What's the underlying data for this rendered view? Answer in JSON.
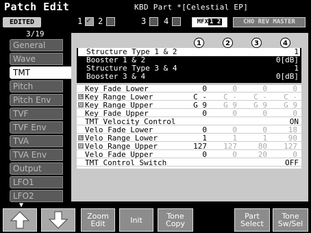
{
  "header": {
    "title": "Patch Edit",
    "part": "KBD Part *[Celestial EP]",
    "status_badge": "EDITED",
    "tones": [
      {
        "num": "1",
        "on": true
      },
      {
        "num": "2",
        "on": false
      },
      {
        "num": "3",
        "on": false
      },
      {
        "num": "4",
        "on": false
      }
    ],
    "fx1_label": "MFX",
    "fx1_inv": "1 2",
    "fx2_label": "CHO REV MASTER"
  },
  "sidebar": {
    "page_counter": "3/19",
    "tabs": [
      "General",
      "Wave",
      "TMT",
      "Pitch",
      "Pitch Env",
      "TVF",
      "TVF Env",
      "TVA",
      "TVA Env",
      "Output",
      "LFO1",
      "LFO2"
    ],
    "active_tab": "TMT"
  },
  "column_headers": [
    "1",
    "2",
    "3",
    "4"
  ],
  "structure": [
    {
      "label": "Structure Type 1 & 2",
      "value": "1"
    },
    {
      "label": "Booster 1 & 2",
      "value": "0[dB]"
    },
    {
      "label": "Structure Type 3 & 4",
      "value": "1"
    },
    {
      "label": "Booster 3 & 4",
      "value": "0[dB]"
    }
  ],
  "rows": [
    {
      "label": "Key Fade Lower",
      "marker": "",
      "values": [
        "0",
        "0",
        "0",
        "0"
      ]
    },
    {
      "label": "Key Range Lower",
      "marker": "L",
      "values": [
        "C -",
        "C -",
        "C -",
        "C -"
      ]
    },
    {
      "label": "Key Range Upper",
      "marker": "U",
      "values": [
        "G 9",
        "G 9",
        "G 9",
        "G 9"
      ]
    },
    {
      "label": "Key Fade Upper",
      "marker": "",
      "values": [
        "0",
        "0",
        "0",
        "0"
      ]
    },
    {
      "label": "TMT Velocity Control",
      "marker": "",
      "full": "ON"
    },
    {
      "label": "Velo Fade Lower",
      "marker": "",
      "values": [
        "0",
        "0",
        "0",
        "18"
      ]
    },
    {
      "label": "Velo Range Lower",
      "marker": "L",
      "values": [
        "1",
        "1",
        "1",
        "90"
      ]
    },
    {
      "label": "Velo Range Upper",
      "marker": "U",
      "values": [
        "127",
        "127",
        "80",
        "127"
      ]
    },
    {
      "label": "Velo Fade Upper",
      "marker": "",
      "values": [
        "0",
        "0",
        "20",
        "0"
      ]
    },
    {
      "label": "TMT Control Switch",
      "marker": "",
      "full": "OFF"
    }
  ],
  "footer": {
    "zoom_edit": "Zoom Edit",
    "init": "Init",
    "tone_copy": "Tone Copy",
    "part_select": "Part Select",
    "tone_sw_sel": "Tone Sw/Sel"
  }
}
